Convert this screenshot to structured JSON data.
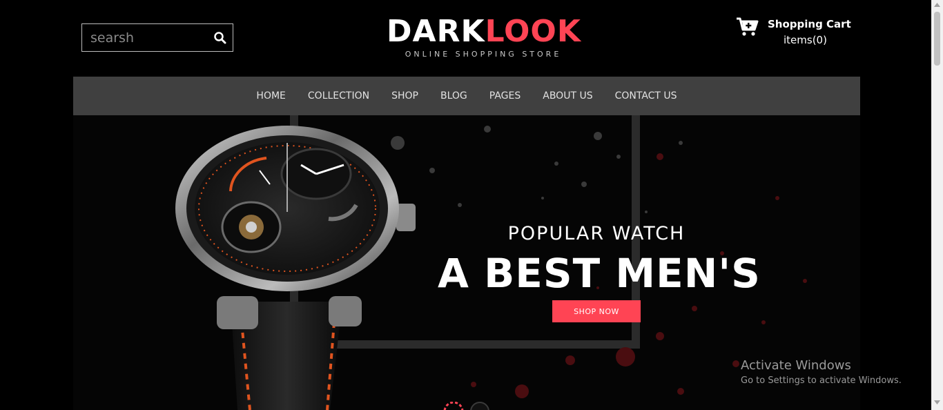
{
  "search": {
    "placeholder": "searsh"
  },
  "icons": {
    "search": "search-icon",
    "cart": "shopping-cart-icon"
  },
  "logo": {
    "part1": "DARK",
    "part2": "LOOK",
    "subtitle": "ONLINE SHOPPING STORE"
  },
  "cart": {
    "title": "Shopping Cart",
    "items": "items(0)"
  },
  "nav": {
    "items": [
      {
        "label": "HOME"
      },
      {
        "label": "COLLECTION"
      },
      {
        "label": "SHOP"
      },
      {
        "label": "BLOG"
      },
      {
        "label": "PAGES"
      },
      {
        "label": "ABOUT US"
      },
      {
        "label": "CONTACT US"
      }
    ]
  },
  "hero": {
    "eyebrow": "POPULAR WATCH",
    "headline": "A BEST MEN'S",
    "cta": "SHOP NOW",
    "slides": {
      "count": 2,
      "active": 1
    }
  },
  "watermark": {
    "title": "Activate Windows",
    "subtitle": "Go to Settings to activate Windows."
  },
  "colors": {
    "accent": "#ff4454",
    "nav_bg": "#404040",
    "page_bg": "#000000"
  }
}
